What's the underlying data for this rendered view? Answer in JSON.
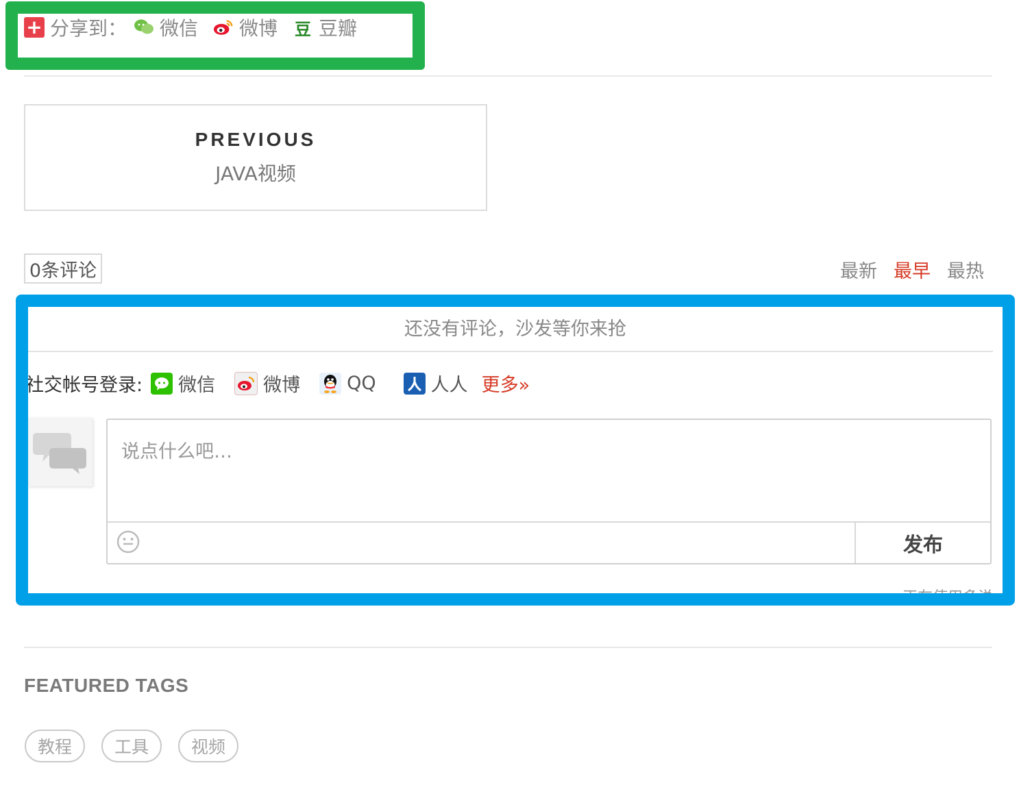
{
  "share": {
    "label": "分享到：",
    "items": [
      {
        "label": "微信",
        "icon": "wechat-icon"
      },
      {
        "label": "微博",
        "icon": "weibo-icon"
      },
      {
        "label": "豆瓣",
        "icon": "douban-icon",
        "glyph": "豆"
      }
    ],
    "plus_glyph": "+"
  },
  "pager": {
    "prev_label": "PREVIOUS",
    "prev_title": "JAVA视频"
  },
  "comments": {
    "count_label": "0条评论",
    "sort_options": [
      "最新",
      "最早",
      "最热"
    ],
    "active_sort": "最早",
    "empty_message": "还没有评论，沙发等你来抢",
    "login_label": "社交帐号登录:",
    "login_items": [
      {
        "label": "微信",
        "icon": "wechat-login-icon"
      },
      {
        "label": "微博",
        "icon": "weibo-login-icon"
      },
      {
        "label": "QQ",
        "icon": "qq-icon"
      },
      {
        "label": "人人",
        "icon": "renren-icon"
      }
    ],
    "more_label": "更多»",
    "placeholder": "说点什么吧…",
    "publish_label": "发布",
    "footer_partial": "… 正在使用多说"
  },
  "featured_tags": {
    "title": "FEATURED TAGS",
    "tags": [
      "教程",
      "工具",
      "视频"
    ]
  },
  "colors": {
    "share_highlight": "#22b14c",
    "widget_highlight": "#00a0e9",
    "accent_red": "#d63b25"
  }
}
